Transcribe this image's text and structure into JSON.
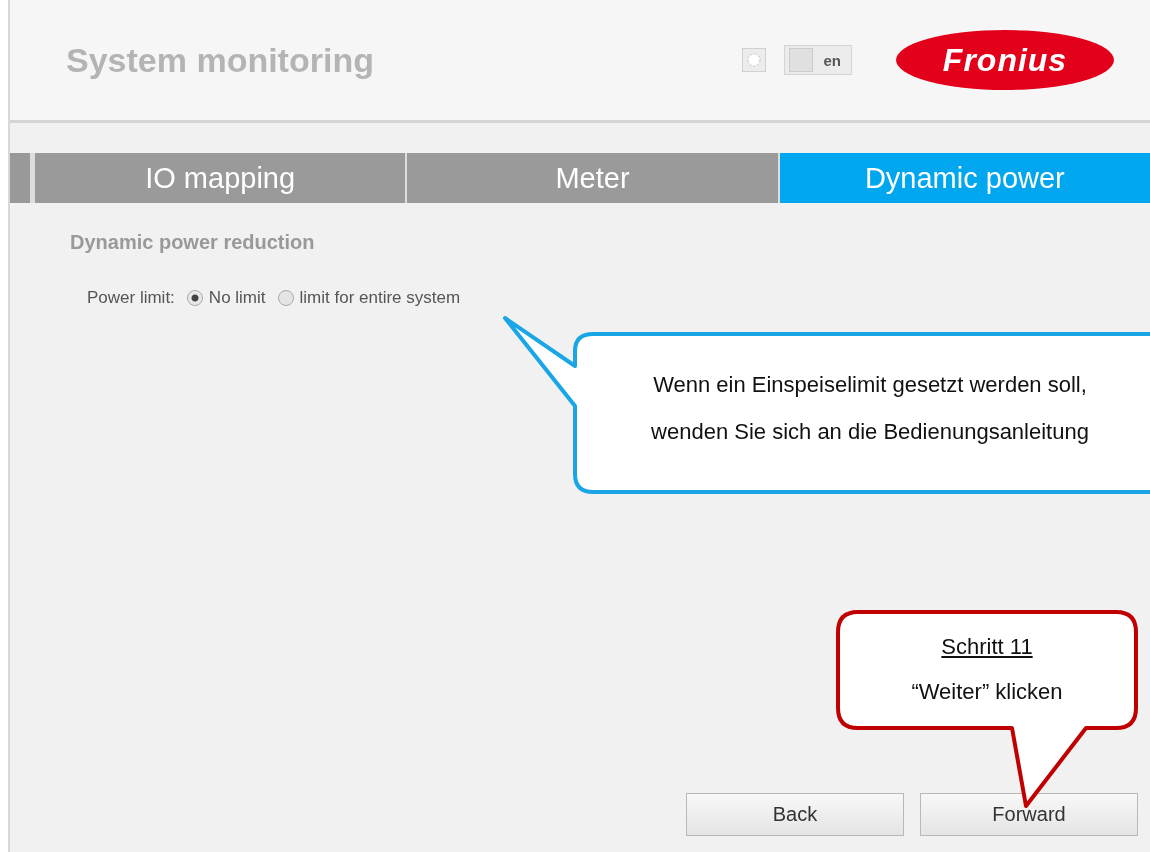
{
  "header": {
    "title": "System monitoring",
    "language": "en",
    "logo": "Fronius"
  },
  "tabs": [
    {
      "label": "IO mapping",
      "selected": false
    },
    {
      "label": "Meter",
      "selected": false
    },
    {
      "label": "Dynamic power",
      "selected": true
    }
  ],
  "section": {
    "title": "Dynamic power reduction",
    "field_label": "Power limit:",
    "options": [
      {
        "label": "No limit",
        "selected": true
      },
      {
        "label": "limit for entire system",
        "selected": false
      }
    ]
  },
  "buttons": [
    "Back",
    "Forward"
  ],
  "callouts": [
    {
      "kind": "info",
      "lines": [
        "Wenn ein Einspeiselimit gesetzt werden soll,",
        "wenden Sie sich an die Bedienungsanleitung"
      ]
    },
    {
      "kind": "step",
      "heading": "Schritt 11",
      "lines": [
        "“Weiter” klicken"
      ]
    }
  ]
}
